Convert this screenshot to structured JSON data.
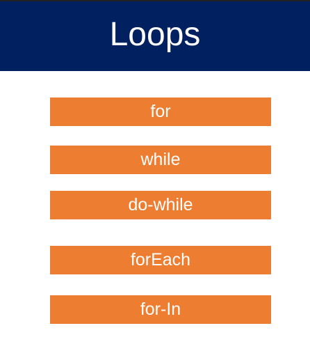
{
  "slide": {
    "title": "Loops",
    "items": [
      "for",
      "while",
      "do-while",
      "forEach",
      "for-In"
    ]
  },
  "colors": {
    "header": "#002060",
    "item": "#ed7d31"
  }
}
